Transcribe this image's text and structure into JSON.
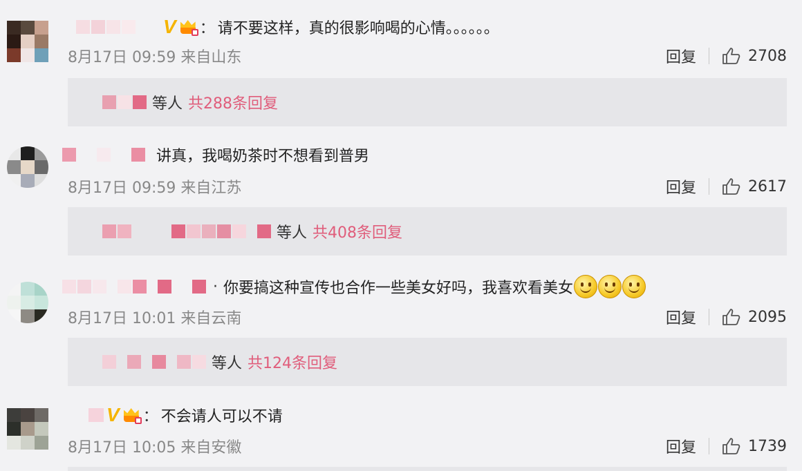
{
  "comments": [
    {
      "text": "请不要这样，真的很影响喝的心情。。。。。。",
      "meta": "8月17日 09:59 来自山东",
      "reply_label": "回复",
      "likes": "2708",
      "replies_prefix": "等人",
      "replies_count": "共288条回复",
      "has_vip": true
    },
    {
      "text": "讲真，我喝奶茶时不想看到普男",
      "meta": "8月17日 09:59 来自江苏",
      "reply_label": "回复",
      "likes": "2617",
      "replies_prefix": "等人",
      "replies_count": "共408条回复"
    },
    {
      "text": "你要搞这种宣传也合作一些美女好吗，我喜欢看美女",
      "meta": "8月17日 10:01 来自云南",
      "reply_label": "回复",
      "likes": "2095",
      "replies_prefix": "等人",
      "replies_count": "共124条回复",
      "emoji_count": 3
    },
    {
      "text": "不会请人可以不请",
      "meta": "8月17日 10:05 来自安徽",
      "reply_label": "回复",
      "likes": "1739",
      "has_vip": true
    }
  ],
  "badge": {
    "v_label": "V",
    "colon": "："
  },
  "colors": {
    "link": "#e05d7b",
    "meta": "#888888",
    "badge": "#f5b400",
    "bg": "#f2f2f4"
  },
  "icons": {
    "like": "thumbs-up-icon",
    "vip": "crown-icon",
    "verified": "verified-v-icon",
    "emoji": "smile-emoji-icon"
  }
}
